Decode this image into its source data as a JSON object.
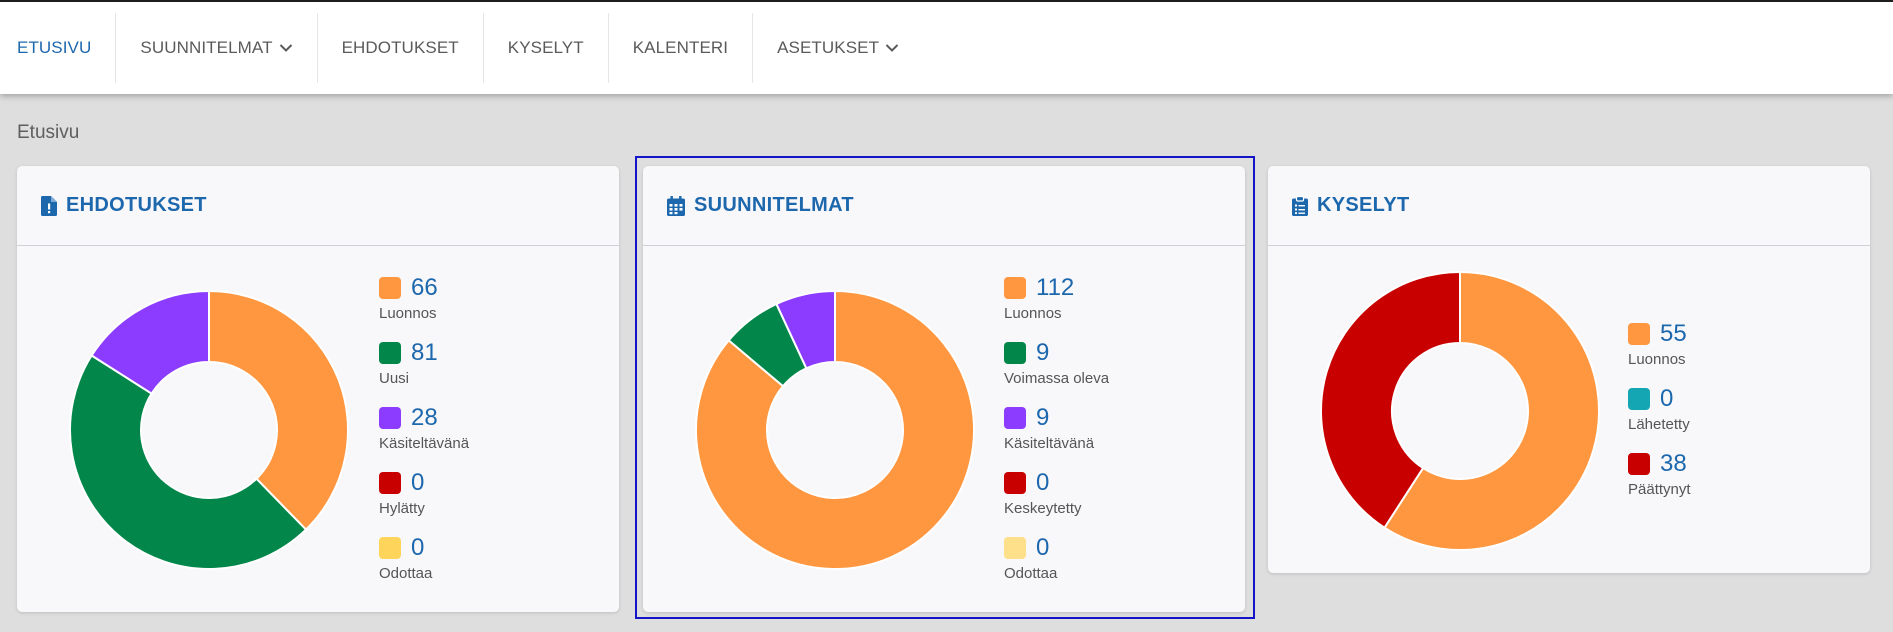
{
  "nav": {
    "items": [
      {
        "label": "ETUSIVU",
        "active": true,
        "dropdown": false
      },
      {
        "label": "SUUNNITELMAT",
        "active": false,
        "dropdown": true
      },
      {
        "label": "EHDOTUKSET",
        "active": false,
        "dropdown": false
      },
      {
        "label": "KYSELYT",
        "active": false,
        "dropdown": false
      },
      {
        "label": "KALENTERI",
        "active": false,
        "dropdown": false
      },
      {
        "label": "ASETUKSET",
        "active": false,
        "dropdown": true
      }
    ]
  },
  "page": {
    "title": "Etusivu"
  },
  "colors": {
    "accent": "#1d67ad",
    "luonnos": "#ff9640",
    "uusi": "#02864a",
    "kasiteltavana": "#8b3cff",
    "hylatty": "#c80000",
    "odottaa": "#ffd45a",
    "lahetetty": "#14a7b3"
  },
  "cards": {
    "ehdotukset": {
      "title": "EHDOTUKSET",
      "icon": "file-alert-icon"
    },
    "suunnitelmat": {
      "title": "SUUNNITELMAT",
      "icon": "calendar-icon"
    },
    "kyselyt": {
      "title": "KYSELYT",
      "icon": "clipboard-list-icon"
    }
  },
  "chart_data": [
    {
      "type": "pie",
      "title": "EHDOTUKSET",
      "categories": [
        "Luonnos",
        "Uusi",
        "Käsiteltävänä",
        "Hylätty",
        "Odottaa"
      ],
      "values": [
        66,
        81,
        28,
        0,
        0
      ],
      "colors": [
        "#ff9640",
        "#02864a",
        "#8b3cff",
        "#c80000",
        "#ffd45a"
      ],
      "legend": "right"
    },
    {
      "type": "pie",
      "title": "SUUNNITELMAT",
      "categories": [
        "Luonnos",
        "Voimassa oleva",
        "Käsiteltävänä",
        "Keskeytetty",
        "Odottaa"
      ],
      "values": [
        112,
        9,
        9,
        0,
        0
      ],
      "colors": [
        "#ff9640",
        "#02864a",
        "#8b3cff",
        "#c80000",
        "#ffe08a"
      ],
      "legend": "right"
    },
    {
      "type": "pie",
      "title": "KYSELYT",
      "categories": [
        "Luonnos",
        "Lähetetty",
        "Päättynyt"
      ],
      "values": [
        55,
        0,
        38
      ],
      "colors": [
        "#ff9640",
        "#14a7b3",
        "#c80000"
      ],
      "legend": "right"
    }
  ]
}
